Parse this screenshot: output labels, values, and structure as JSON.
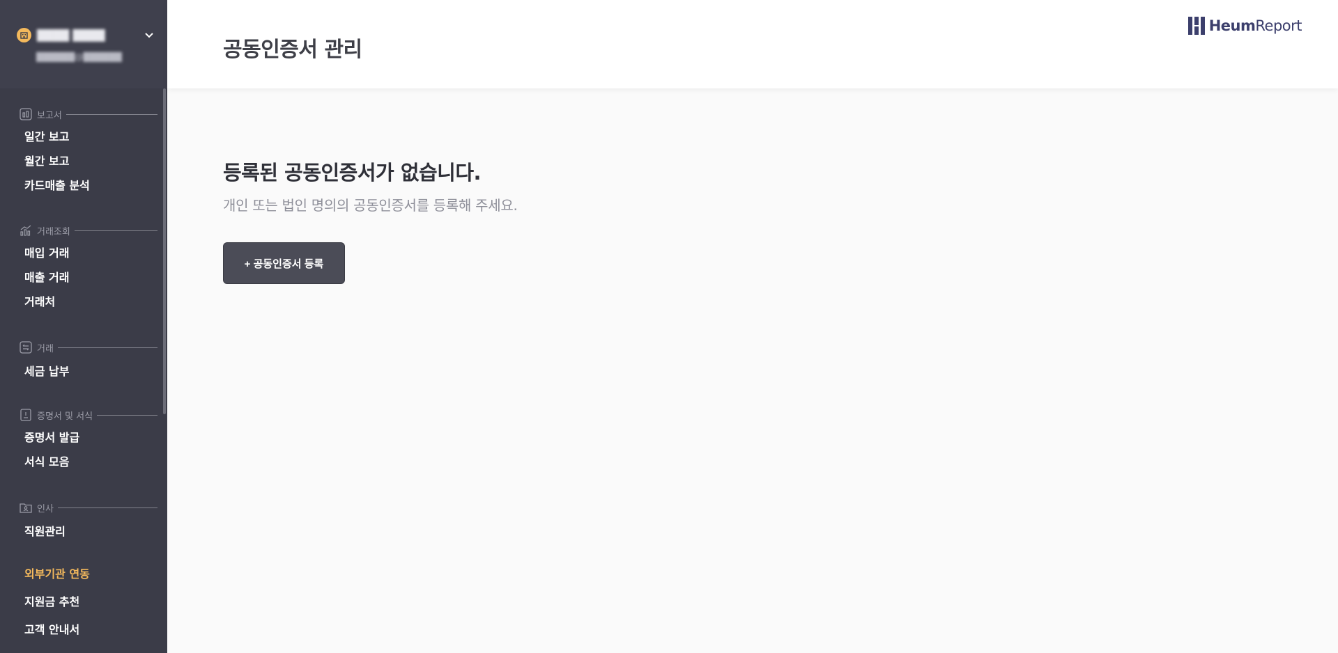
{
  "account": {
    "name": "████ ████",
    "email": "██████@██████"
  },
  "sidebar": {
    "sections": [
      {
        "label": "보고서",
        "icon": "report-icon",
        "items": [
          "일간 보고",
          "월간 보고",
          "카드매출 분석"
        ]
      },
      {
        "label": "거래조회",
        "icon": "chart-icon",
        "items": [
          "매입 거래",
          "매출 거래",
          "거래처"
        ]
      },
      {
        "label": "거래",
        "icon": "exchange-icon",
        "items": [
          "세금 납부"
        ]
      },
      {
        "label": "증명서 및 서식",
        "icon": "certificate-icon",
        "items": [
          "증명서 발급",
          "서식 모음"
        ]
      },
      {
        "label": "인사",
        "icon": "person-folder-icon",
        "items": [
          "직원관리"
        ]
      }
    ],
    "bottom": [
      "외부기관 연동",
      "지원금 추천",
      "고객 안내서"
    ]
  },
  "header": {
    "title": "공동인증서 관리",
    "logo_bold": "Heum",
    "logo_light": "Report"
  },
  "main": {
    "empty_title": "등록된 공동인증서가 없습니다.",
    "empty_subtitle": "개인 또는 법인 명의의 공동인증서를 등록해 주세요.",
    "register_button": "+ 공동인증서 등록"
  },
  "colors": {
    "sidebar_bg": "#3b3c48",
    "accent": "#f4b95c",
    "logo": "#3c3f6c",
    "button_bg": "#4b4c57"
  }
}
